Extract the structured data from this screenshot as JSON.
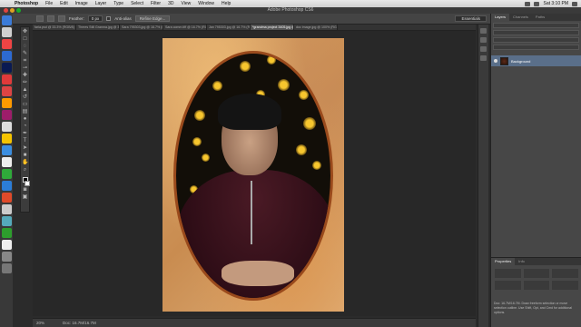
{
  "menubar": {
    "app": "Photoshop",
    "items": [
      "File",
      "Edit",
      "Image",
      "Layer",
      "Type",
      "Select",
      "Filter",
      "3D",
      "View",
      "Window",
      "Help"
    ],
    "clock": "Sat 3:10 PM"
  },
  "window": {
    "title": "Adobe Photoshop CS6"
  },
  "options": {
    "feather_label": "Feather:",
    "feather_value": "0 px",
    "antialias_label": "Anti-alias",
    "refine_edge": "Refine Edge...",
    "workspace": "Essentials"
  },
  "tabs": [
    "faria.psd @ 33.3% (RGB/8)",
    "Theres Still Granma.jpg @ 33.3% (RGB/8)",
    "Sara 795303.jpg @ 16.7% (RGB/8)",
    "Sara comm.tiff @ 16.7% (RGB/8)",
    "Jan 795303.jpg @ 16.7% (RGB/8)",
    "*grandma project 3405.jpg @ 20% (RGB/8)",
    "doc image.jpg @ 100% (RGB/8)"
  ],
  "active_tab_index": 5,
  "statusbar": {
    "zoom": "20%",
    "doc": "Doc: 16.7M/16.7M"
  },
  "panels": {
    "tabs": [
      "Layers",
      "Channels",
      "Paths"
    ],
    "layer_name": "Background",
    "props_tabs": [
      "Properties",
      "Info"
    ],
    "help_text": "Doc: 16.7M/16.7M. Draw freeform selection or move selection outline. Use Shift, Opt, and Cmd for additional options."
  },
  "colors": {
    "frame": "#9a4a1c",
    "bokeh": "#f7c62e",
    "sweater": "#3a1220"
  }
}
